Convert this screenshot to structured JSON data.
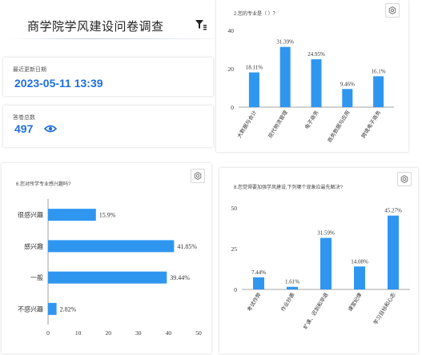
{
  "header": {
    "title": "商学院学风建设问卷调查",
    "filter_icon": "filter-icon"
  },
  "last_update": {
    "label": "最近更新日期",
    "value": "2023-05-11 13:39"
  },
  "total_answers": {
    "label": "答卷总数",
    "value": "497",
    "icon": "eye-icon"
  },
  "colors": {
    "bar": "#2f96f0",
    "accent": "#1e6fe0"
  },
  "chart_data": [
    {
      "type": "bar",
      "title": "2.您的专业是（ ）？",
      "categories": [
        "大数据与会计",
        "现代物流管理",
        "电子商务",
        "商务数据与应用",
        "跨境电子商务"
      ],
      "values": [
        18.11,
        31.39,
        24.95,
        9.46,
        16.1
      ],
      "labels": [
        "18.11%",
        "31.39%",
        "24.95%",
        "9.46%",
        "16.1%"
      ],
      "ylim": [
        0,
        40
      ],
      "yticks": [
        0,
        20,
        40
      ],
      "grid": false
    },
    {
      "type": "bar",
      "orientation": "horizontal",
      "title": "6.您对所学专业感兴趣吗?",
      "categories": [
        "很感兴趣",
        "感兴趣",
        "一般",
        "不感兴趣"
      ],
      "values": [
        15.9,
        41.85,
        39.44,
        2.82
      ],
      "labels": [
        "15.9%",
        "41.85%",
        "39.44%",
        "2.82%"
      ],
      "xlim": [
        0,
        50
      ],
      "xticks": [
        0,
        10,
        20,
        30,
        40,
        50
      ],
      "grid": false
    },
    {
      "type": "bar",
      "title": "8.您觉得要加强学风建设,下列哪个现象应最先解决?",
      "categories": [
        "考试作弊",
        "作业抄袭",
        "旷课、迟到和早退",
        "课堂纪律",
        "学习目标和心态"
      ],
      "values": [
        7.44,
        1.61,
        31.59,
        14.08,
        45.27
      ],
      "labels": [
        "7.44%",
        "1.61%",
        "31.59%",
        "14.08%",
        "45.27%"
      ],
      "ylim": [
        0,
        50
      ],
      "yticks": [
        0,
        25,
        50
      ],
      "grid": false
    }
  ]
}
